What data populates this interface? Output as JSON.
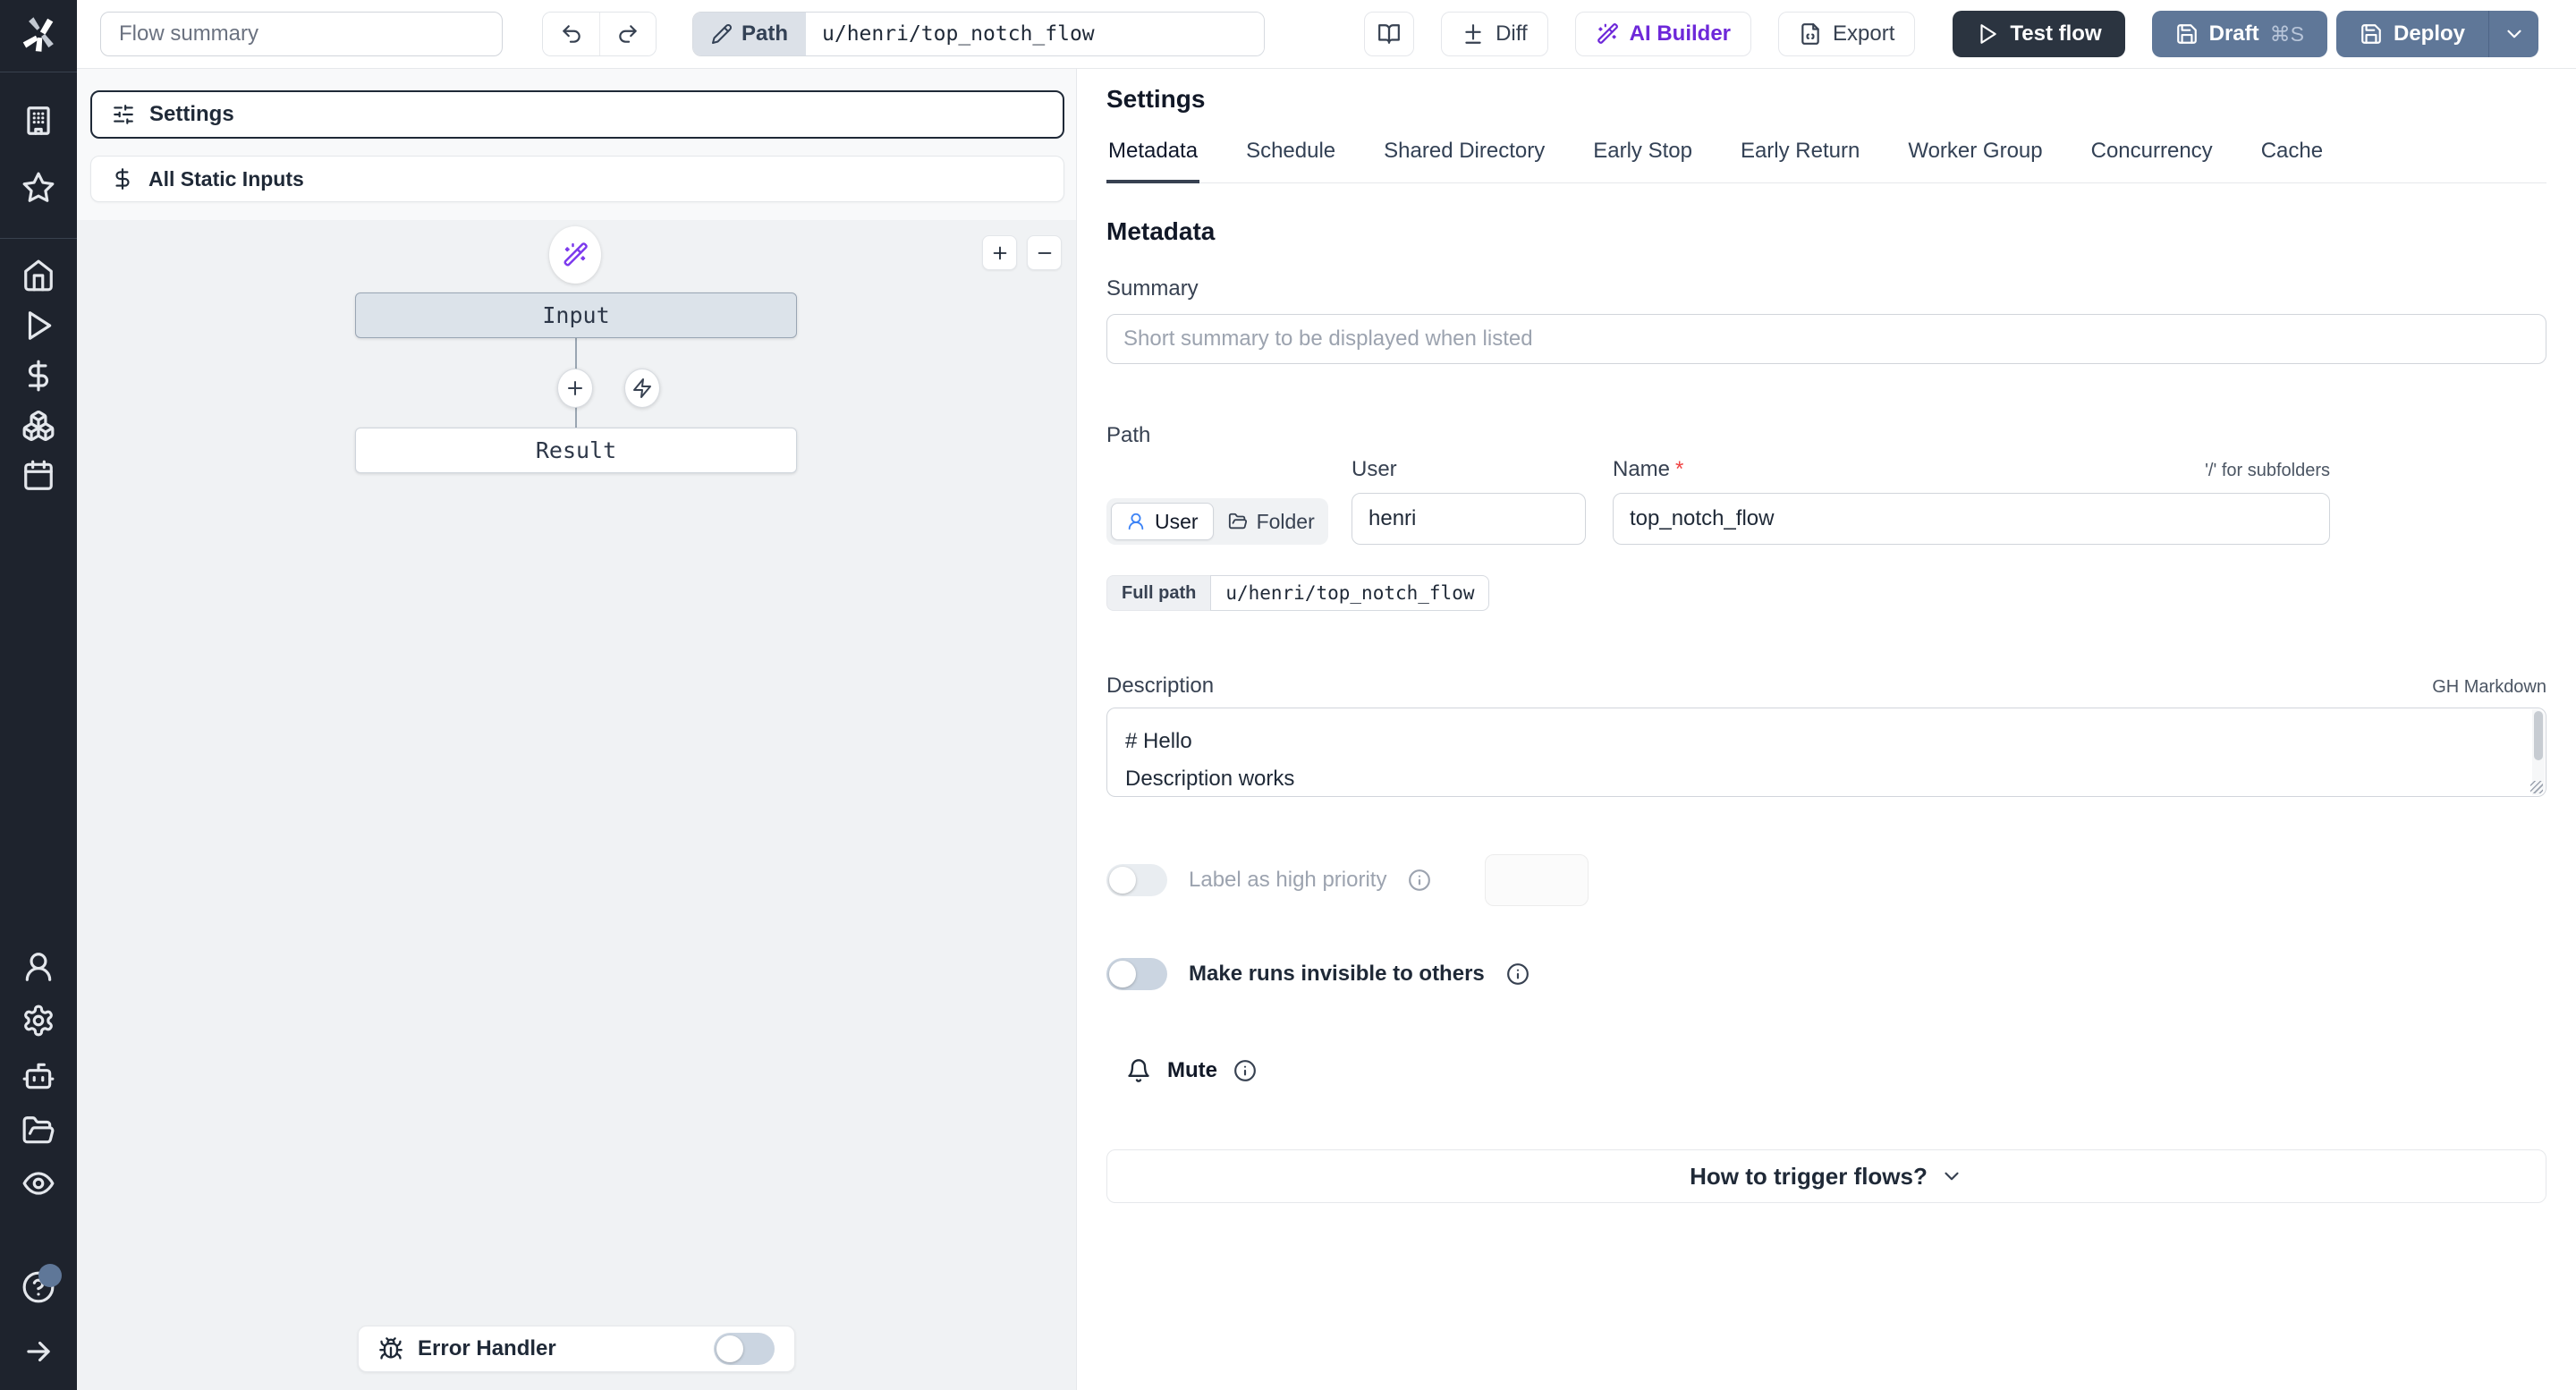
{
  "topbar": {
    "flow_summary_placeholder": "Flow summary",
    "path_button": "Path",
    "path_value": "u/henri/top_notch_flow",
    "diff_label": "Diff",
    "ai_builder_label": "AI Builder",
    "export_label": "Export",
    "test_flow_label": "Test flow",
    "draft_label": "Draft",
    "draft_shortcut": "⌘S",
    "deploy_label": "Deploy"
  },
  "sidebar": {
    "icons": [
      "windmill-logo",
      "building-icon",
      "star-icon",
      "home-icon",
      "runs-play-icon",
      "variables-dollar-icon",
      "resources-boxes-icon",
      "schedules-calendar-icon",
      "user-icon",
      "settings-gear-icon",
      "workers-robot-icon",
      "folders-icon",
      "audit-eye-icon",
      "help-icon",
      "expand-arrow-icon"
    ]
  },
  "flow_panel": {
    "settings_card_label": "Settings",
    "static_inputs_card_label": "All Static Inputs",
    "input_node_label": "Input",
    "result_node_label": "Result",
    "error_handler_label": "Error Handler"
  },
  "settings_panel": {
    "title": "Settings",
    "tabs": [
      {
        "label": "Metadata",
        "active": true
      },
      {
        "label": "Schedule",
        "active": false
      },
      {
        "label": "Shared Directory",
        "active": false
      },
      {
        "label": "Early Stop",
        "active": false
      },
      {
        "label": "Early Return",
        "active": false
      },
      {
        "label": "Worker Group",
        "active": false
      },
      {
        "label": "Concurrency",
        "active": false
      },
      {
        "label": "Cache",
        "active": false
      }
    ],
    "metadata": {
      "heading": "Metadata",
      "summary_label": "Summary",
      "summary_placeholder": "Short summary to be displayed when listed",
      "path_label": "Path",
      "owner_user_option": "User",
      "owner_folder_option": "Folder",
      "user_field_label": "User",
      "user_value": "henri",
      "name_field_label": "Name",
      "name_required_mark": "*",
      "name_value": "top_notch_flow",
      "subfolder_hint": "'/' for subfolders",
      "full_path_label": "Full path",
      "full_path_value": "u/henri/top_notch_flow",
      "description_label": "Description",
      "markdown_hint": "GH Markdown",
      "description_value": "# Hello\nDescription works",
      "high_priority_label": "Label as high priority",
      "invisible_runs_label": "Make runs invisible to others",
      "mute_label": "Mute",
      "trigger_collapsible_label": "How to trigger flows?"
    }
  },
  "colors": {
    "sidebar_bg": "#1e232d",
    "accent_purple": "#6d28d9",
    "deploy_blue": "#5f7798",
    "dark_button": "#2b3440",
    "selected_node_bg": "#dce3ea",
    "canvas_bg": "#f0f2f4",
    "required_red": "#ef4444",
    "selected_icon_blue": "#3b82f6"
  }
}
